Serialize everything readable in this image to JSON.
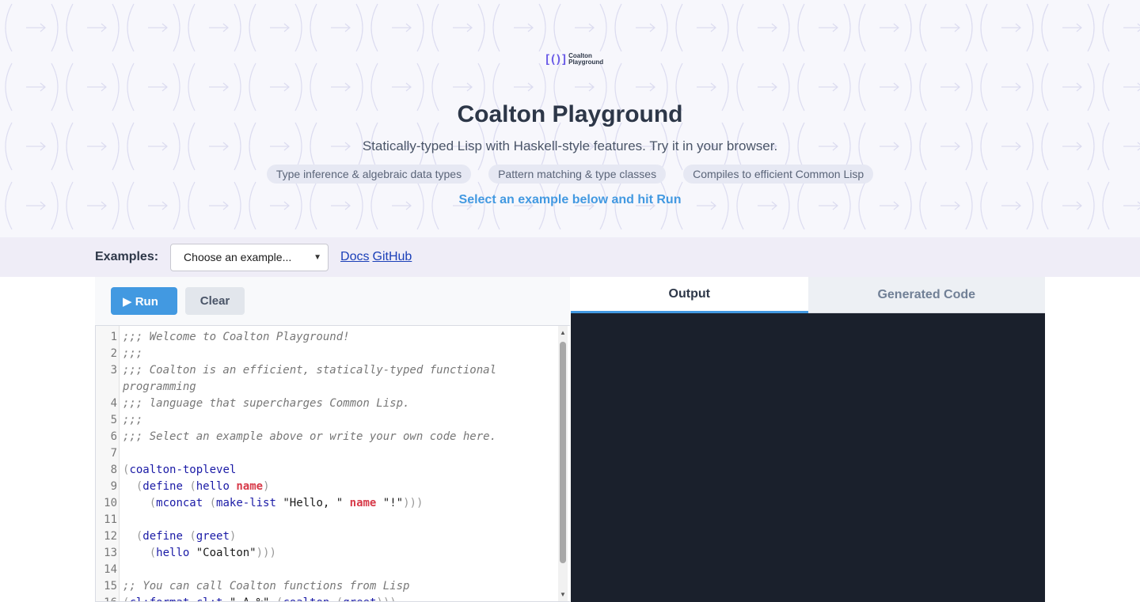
{
  "hero": {
    "logo_line1": "Coalton",
    "logo_line2": "Playground",
    "title": "Coalton Playground",
    "subtitle": "Statically-typed Lisp with Haskell-style features. Try it in your browser.",
    "pills": [
      "Type inference & algebraic data types",
      "Pattern matching & type classes",
      "Compiles to efficient Common Lisp"
    ],
    "hint": " Select an example below and hit Run"
  },
  "toolbar": {
    "examples_label": "Examples:",
    "select_value": "Choose an example...",
    "docs_link": " Docs",
    "github_link": " GitHub"
  },
  "editor": {
    "run_label": "▶ Run",
    "clear_label": "Clear",
    "line_numbers": [
      "1",
      "2",
      "3",
      "",
      "4",
      "5",
      "6",
      "7",
      "8",
      "9",
      "10",
      "11",
      "12",
      "13",
      "14",
      "15",
      "16"
    ]
  },
  "output": {
    "tab_output": "Output",
    "tab_generated": "Generated Code"
  },
  "colors": {
    "accent": "#4299e1",
    "output_bg": "#1a202c",
    "hero_bg": "#f7f7fc"
  }
}
